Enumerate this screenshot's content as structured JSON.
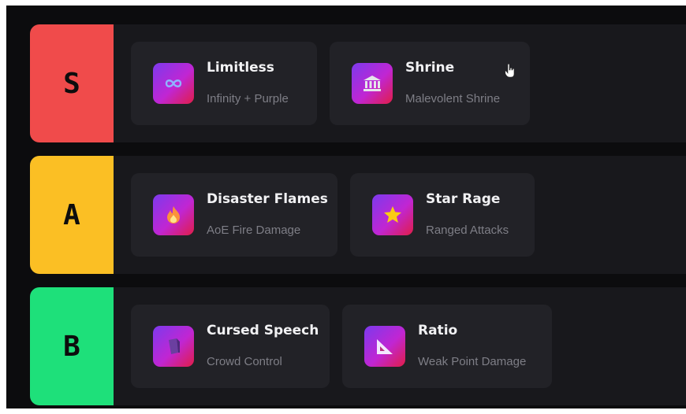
{
  "colors": {
    "tier_s": "#f04b4b",
    "tier_a": "#fbbf24",
    "tier_b": "#1ee07a",
    "background": "#0c0c0e",
    "row": "#18181c",
    "card": "#222227"
  },
  "tiers": [
    {
      "label": "S",
      "cards": [
        {
          "title": "Limitless",
          "subtitle": "Infinity + Purple",
          "icon": "infinity-icon"
        },
        {
          "title": "Shrine",
          "subtitle": "Malevolent Shrine",
          "icon": "temple-icon"
        }
      ]
    },
    {
      "label": "A",
      "cards": [
        {
          "title": "Disaster Flames",
          "subtitle": "AoE Fire Damage",
          "icon": "fire-icon"
        },
        {
          "title": "Star Rage",
          "subtitle": "Ranged Attacks",
          "icon": "star-icon"
        }
      ]
    },
    {
      "label": "B",
      "cards": [
        {
          "title": "Cursed Speech",
          "subtitle": "Crowd Control",
          "icon": "cursed-speech-icon"
        },
        {
          "title": "Ratio",
          "subtitle": "Weak Point Damage",
          "icon": "triangle-ruler-icon"
        }
      ]
    }
  ]
}
